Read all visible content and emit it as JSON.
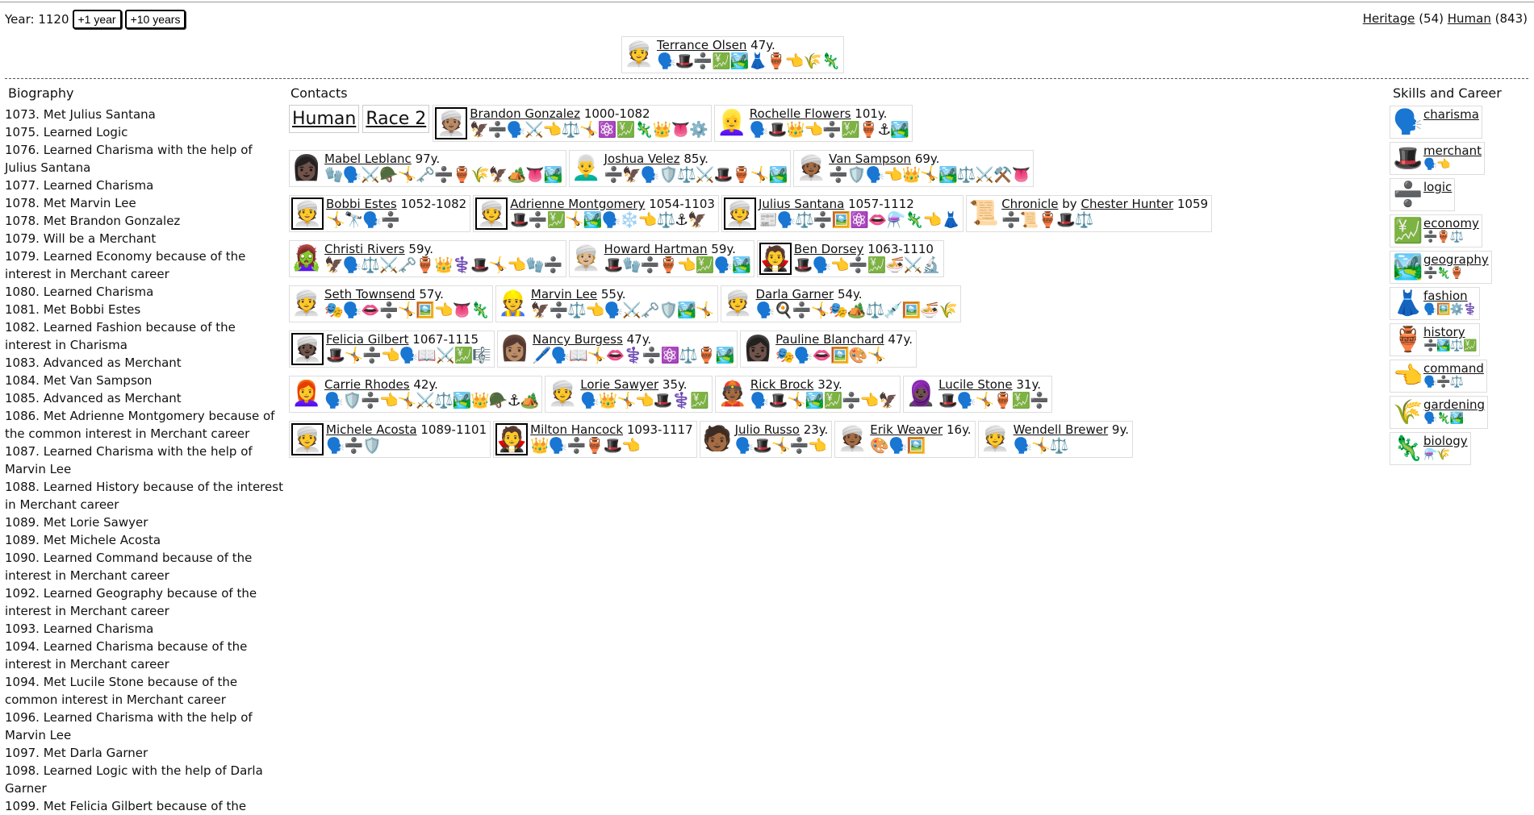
{
  "year_label": "Year: 1120",
  "buttons": {
    "plus1": "+1 year",
    "plus10": "+10 years"
  },
  "topright": {
    "heritage": "Heritage",
    "heritage_count": "(54)",
    "human": "Human",
    "human_count": "(843)"
  },
  "top_person": {
    "avatar": "👳",
    "name": "Terrance Olsen",
    "age": "47y.",
    "skills": "🗣️🎩➗💹🏞️👗🏺👈🌾🦎"
  },
  "sections": {
    "biography": "Biography",
    "contacts": "Contacts",
    "skills": "Skills and Career"
  },
  "races": [
    "Human",
    "Race 2"
  ],
  "biography": [
    "1073. Met Julius Santana",
    "1075. Learned Logic",
    "1076. Learned Charisma with the help of Julius Santana",
    "1077. Learned Charisma",
    "1078. Met Marvin Lee",
    "1078. Met Brandon Gonzalez",
    "1079. Will be a Merchant",
    "1079. Learned Economy because of the interest in Merchant career",
    "1080. Learned Charisma",
    "1081. Met Bobbi Estes",
    "1082. Learned Fashion because of the interest in Charisma",
    "1083. Advanced as Merchant",
    "1084. Met Van Sampson",
    "1085. Advanced as Merchant",
    "1086. Met Adrienne Montgomery because of the common interest in Merchant career",
    "1087. Learned Charisma with the help of Marvin Lee",
    "1088. Learned History because of the interest in Merchant career",
    "1089. Met Lorie Sawyer",
    "1089. Met Michele Acosta",
    "1090. Learned Command because of the interest in Merchant career",
    "1092. Learned Geography because of the interest in Merchant career",
    "1093. Learned Charisma",
    "1094. Learned Charisma because of the interest in Merchant career",
    "1094. Met Lucile Stone because of the common interest in Merchant career",
    "1096. Learned Charisma with the help of Marvin Lee",
    "1097. Met Darla Garner",
    "1098. Learned Logic with the help of Darla Garner",
    "1099. Met Felicia Gilbert because of the"
  ],
  "contact_rows": [
    [
      {
        "avatar": "👳🏽",
        "sel": true,
        "name": "Brandon Gonzalez",
        "age": "1000-1082",
        "skills": "🦅➗🗣️⚔️👈⚖️🤸⚛️💹🦎👑👅⚙️"
      },
      {
        "avatar": "👱‍♀️",
        "sel": false,
        "name": "Rochelle Flowers",
        "age": "101y.",
        "skills": "🗣️🎩👑👈➗💹🏺⚓🏞️"
      }
    ],
    [
      {
        "avatar": "👩🏿",
        "sel": false,
        "name": "Mabel Leblanc",
        "age": "97y.",
        "skills": "🧤🗣️⚔️🪖🤸🗝️➗🏺🌾🦅🏕️👅🏞️"
      },
      {
        "avatar": "👨‍🦳",
        "sel": false,
        "name": "Joshua Velez",
        "age": "85y.",
        "skills": "➗🦅🗣️🛡️⚖️⚔️🎩🏺🤸🏞️"
      },
      {
        "avatar": "👳🏾",
        "sel": false,
        "name": "Van Sampson",
        "age": "69y.",
        "skills": "➗🛡️🗣️👈👑🤸🏞️⚖️⚔️⚒️👅"
      }
    ],
    [
      {
        "avatar": "👳",
        "sel": true,
        "name": "Bobbi Estes",
        "age": "1052-1082",
        "skills": "🤸🔭🗣️➗"
      },
      {
        "avatar": "👳",
        "sel": true,
        "name": "Adrienne Montgomery",
        "age": "1054-1103",
        "skills": "🎩➗💹🤸🏞️🗣️❄️👈⚖️⚓🦅"
      },
      {
        "avatar": "👳",
        "sel": true,
        "name": "Julius Santana",
        "age": "1057-1112",
        "skills": "📰🗣️⚖️➗🖼️⚛️👄⚗️🦎👈👗"
      },
      {
        "avatar": "📜",
        "sel": false,
        "chronicle": true,
        "name": "Chronicle",
        "by": "by",
        "author": "Chester Hunter",
        "age": "1059",
        "skills": "➗📜🏺🎩⚖️"
      }
    ],
    [
      {
        "avatar": "🧟‍♀️",
        "sel": false,
        "name": "Christi Rivers",
        "age": "59y.",
        "skills": "🦅🗣️⚖️⚔️🗝️🏺👑⚕️🎩🤸👈🧤➗"
      },
      {
        "avatar": "👳🏼",
        "sel": false,
        "name": "Howard Hartman",
        "age": "59y.",
        "skills": "🎩🧤➗🏺👈💹🗣️🏞️"
      },
      {
        "avatar": "🧛",
        "sel": true,
        "name": "Ben Dorsey",
        "age": "1063-1110",
        "skills": "🎩🗣️👈➗💹🍜⚔️🔬"
      }
    ],
    [
      {
        "avatar": "👳",
        "sel": false,
        "name": "Seth Townsend",
        "age": "57y.",
        "skills": "🎭🗣️👄➗🤸🖼️👈👅🦎"
      },
      {
        "avatar": "👷",
        "sel": false,
        "name": "Marvin Lee",
        "age": "55y.",
        "skills": "🦅➗⚖️👈🗣️⚔️🗝️🛡️🏞️🤸"
      },
      {
        "avatar": "👳",
        "sel": false,
        "name": "Darla Garner",
        "age": "54y.",
        "skills": "🗣️🍳➗🤸🎭🏕️⚖️💉🖼️🍜🌾"
      }
    ],
    [
      {
        "avatar": "👳🏿",
        "sel": true,
        "name": "Felicia Gilbert",
        "age": "1067-1115",
        "skills": "🎩🤸➗👈🗣️📖⚔️💹🎼"
      },
      {
        "avatar": "👩🏽",
        "sel": false,
        "name": "Nancy Burgess",
        "age": "47y.",
        "skills": "🖊️🗣️📖🤸👄⚕️➗⚛️⚖️🏺🏞️"
      },
      {
        "avatar": "👩🏿",
        "sel": false,
        "name": "Pauline Blanchard",
        "age": "47y.",
        "skills": "🎭🗣️👄🖼️🎨🤸"
      }
    ],
    [
      {
        "avatar": "👩‍🦰",
        "sel": false,
        "name": "Carrie Rhodes",
        "age": "42y.",
        "skills": "🗣️🛡️➗👈🤸⚔️⚖️🏞️👑🪖⚓🏕️"
      },
      {
        "avatar": "👳",
        "sel": false,
        "name": "Lorie Sawyer",
        "age": "35y.",
        "skills": "🗣️👑🤸👈🎩⚕️💹"
      },
      {
        "avatar": "👲🏾",
        "sel": false,
        "name": "Rick Brock",
        "age": "32y.",
        "skills": "🗣️🎩🤸🏞️💹➗👈🦅"
      },
      {
        "avatar": "🧕🏿",
        "sel": false,
        "name": "Lucile Stone",
        "age": "31y.",
        "skills": "🎩🗣️🤸🏺💹➗"
      }
    ],
    [
      {
        "avatar": "👳",
        "sel": true,
        "name": "Michele Acosta",
        "age": "1089-1101",
        "skills": "🗣️➗🛡️"
      },
      {
        "avatar": "🧛",
        "sel": true,
        "name": "Milton Hancock",
        "age": "1093-1117",
        "skills": "👑🗣️➗🏺🎩👈"
      },
      {
        "avatar": "🧑🏾",
        "sel": false,
        "name": "Julio Russo",
        "age": "23y.",
        "skills": "🗣️🎩🤸➗👈"
      },
      {
        "avatar": "👳🏾",
        "sel": false,
        "name": "Erik Weaver",
        "age": "16y.",
        "skills": "🎨🗣️🖼️"
      },
      {
        "avatar": "👳",
        "sel": false,
        "name": "Wendell Brewer",
        "age": "9y.",
        "skills": "🗣️🤸⚖️"
      }
    ]
  ],
  "skills": [
    {
      "icon": "🗣️",
      "name": "charisma",
      "sub": ""
    },
    {
      "icon": "🎩",
      "name": "merchant",
      "sub": "🗣️👈"
    },
    {
      "icon": "➗",
      "name": "logic",
      "sub": ""
    },
    {
      "icon": "💹",
      "name": "economy",
      "sub": "➗🏺⚖️"
    },
    {
      "icon": "🏞️",
      "name": "geography",
      "sub": "➗🦎🏺"
    },
    {
      "icon": "👗",
      "name": "fashion",
      "sub": "🗣️🖼️⚙️⚕️"
    },
    {
      "icon": "🏺",
      "name": "history",
      "sub": "➗🏞️⚖️💹"
    },
    {
      "icon": "👈",
      "name": "command",
      "sub": "🗣️➗⚖️"
    },
    {
      "icon": "🌾",
      "name": "gardening",
      "sub": "🗣️🦎🏞️"
    },
    {
      "icon": "🦎",
      "name": "biology",
      "sub": "⚗️🌾"
    }
  ]
}
